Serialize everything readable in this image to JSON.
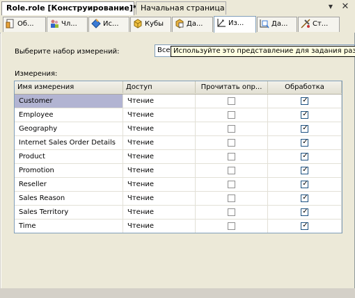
{
  "document_tabs": [
    {
      "label": "Role.role [Конструирование]*",
      "active": true
    },
    {
      "label": "Начальная страница",
      "active": false
    }
  ],
  "window_buttons": {
    "pin_icon": "pin-icon",
    "close_icon": "close-icon",
    "pin_glyph": "▼",
    "close_glyph": "✕"
  },
  "designer_tabs": [
    {
      "label": "Об...",
      "icon": "general-icon",
      "active": false
    },
    {
      "label": "Чл...",
      "icon": "members-icon",
      "active": false
    },
    {
      "label": "Ис...",
      "icon": "data-sources-icon",
      "active": false
    },
    {
      "label": "Кубы",
      "icon": "cubes-icon",
      "active": false
    },
    {
      "label": "Да...",
      "icon": "cell-data-icon",
      "active": false
    },
    {
      "label": "Из...",
      "icon": "dimensions-icon",
      "active": true
    },
    {
      "label": "Да...",
      "icon": "dimension-data-icon",
      "active": false
    },
    {
      "label": "Ст...",
      "icon": "mining-structures-icon",
      "active": false
    }
  ],
  "dimension_set": {
    "label": "Выберите набор измерений:",
    "value": "Все",
    "tooltip": "Используйте это представление для задания разре"
  },
  "dimensions": {
    "label": "Измерения:",
    "columns": [
      "Имя измерения",
      "Доступ",
      "Прочитать опр...",
      "Обработка"
    ],
    "rows": [
      {
        "name": "Customer",
        "access": "Чтение",
        "read_definition": false,
        "process": true,
        "selected": true
      },
      {
        "name": "Employee",
        "access": "Чтение",
        "read_definition": false,
        "process": true,
        "selected": false
      },
      {
        "name": "Geography",
        "access": "Чтение",
        "read_definition": false,
        "process": true,
        "selected": false
      },
      {
        "name": "Internet Sales Order Details",
        "access": "Чтение",
        "read_definition": false,
        "process": true,
        "selected": false
      },
      {
        "name": "Product",
        "access": "Чтение",
        "read_definition": false,
        "process": true,
        "selected": false
      },
      {
        "name": "Promotion",
        "access": "Чтение",
        "read_definition": false,
        "process": true,
        "selected": false
      },
      {
        "name": "Reseller",
        "access": "Чтение",
        "read_definition": false,
        "process": true,
        "selected": false
      },
      {
        "name": "Sales Reason",
        "access": "Чтение",
        "read_definition": false,
        "process": true,
        "selected": false
      },
      {
        "name": "Sales Territory",
        "access": "Чтение",
        "read_definition": false,
        "process": true,
        "selected": false
      },
      {
        "name": "Time",
        "access": "Чтение",
        "read_definition": false,
        "process": true,
        "selected": false
      }
    ]
  },
  "colors": {
    "accent": "#7f9db9",
    "selection": "#b2b4d2",
    "tooltip_bg": "#ffffe1"
  }
}
